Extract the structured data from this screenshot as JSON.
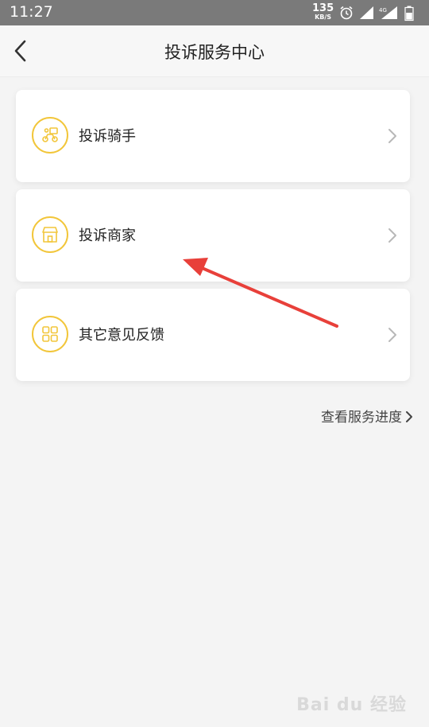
{
  "status_bar": {
    "time": "11:27",
    "net_speed": "135",
    "net_speed_unit": "KB/S",
    "network_label": "4G"
  },
  "nav": {
    "title": "投诉服务中心"
  },
  "menu": [
    {
      "label": "投诉骑手",
      "icon": "rider-scooter-icon"
    },
    {
      "label": "投诉商家",
      "icon": "shop-storefront-icon"
    },
    {
      "label": "其它意见反馈",
      "icon": "grid-apps-icon"
    }
  ],
  "progress_link": {
    "label": "查看服务进度"
  },
  "watermark": {
    "text": "Bai du 经验"
  },
  "colors": {
    "accent": "#f2c63a",
    "status_bar": "#7a7a7a",
    "annotation_arrow": "#e8403a"
  }
}
